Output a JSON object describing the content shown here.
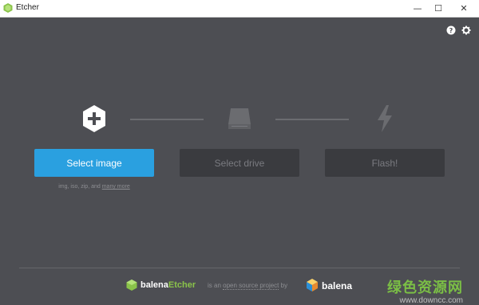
{
  "window": {
    "title": "Etcher",
    "controls": {
      "minimize": "—",
      "maximize": "☐",
      "close": "✕"
    }
  },
  "toolbar": {
    "help_icon": "question-circle-icon",
    "settings_icon": "gear-icon"
  },
  "steps": {
    "image": {
      "icon": "plus-hexagon-icon",
      "button_label": "Select image",
      "hint_prefix": "img, iso, zip, and ",
      "hint_link": "many more"
    },
    "drive": {
      "icon": "drive-icon",
      "button_label": "Select drive"
    },
    "flash": {
      "icon": "lightning-icon",
      "button_label": "Flash!"
    }
  },
  "footer": {
    "brand_prefix": "balena",
    "brand_product": "Etcher",
    "tagline_prefix": "is an ",
    "tagline_link": "open source project",
    "tagline_suffix": " by",
    "company": "balena"
  },
  "watermark": {
    "text": "绿色资源网",
    "url": "www.downcc.com"
  },
  "colors": {
    "background": "#4d4e53",
    "primary": "#2aa0e0",
    "disabled_button": "#3a3b3f",
    "brand_green": "#8ac34a"
  }
}
